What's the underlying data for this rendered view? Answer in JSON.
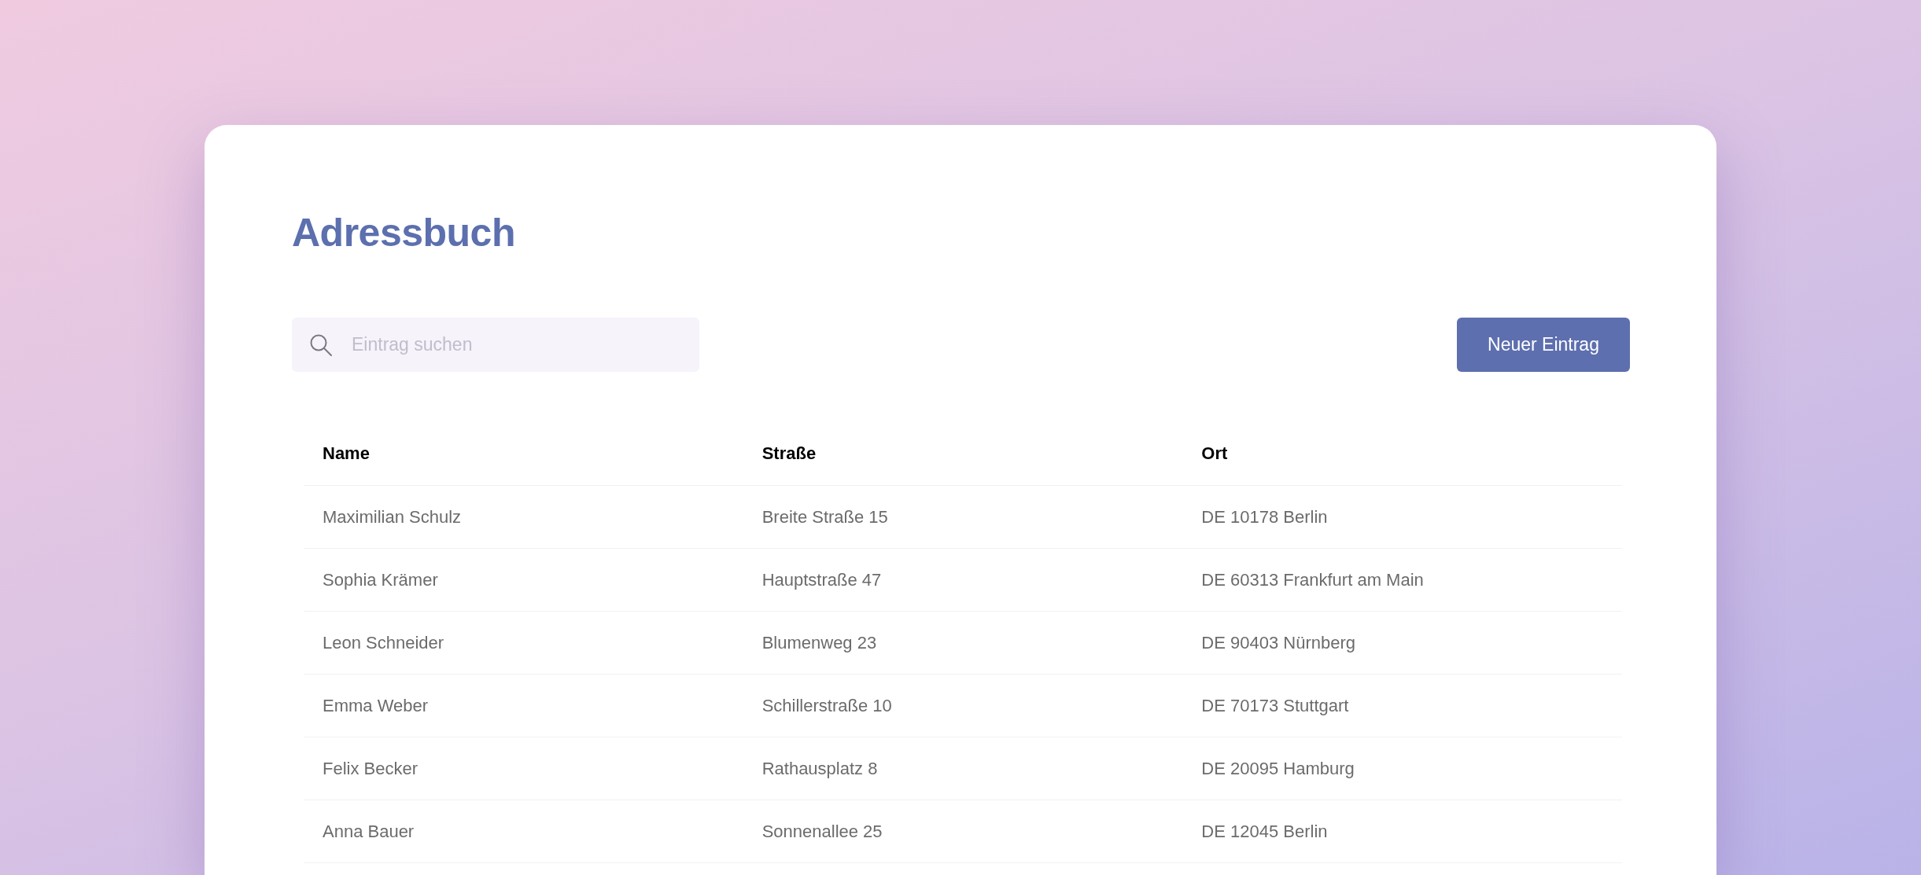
{
  "title": "Adressbuch",
  "search": {
    "placeholder": "Eintrag suchen"
  },
  "new_button": "Neuer Eintrag",
  "table": {
    "columns": [
      "Name",
      "Straße",
      "Ort"
    ],
    "rows": [
      [
        "Maximilian Schulz",
        "Breite Straße 15",
        "DE 10178 Berlin"
      ],
      [
        "Sophia Krämer",
        "Hauptstraße 47",
        "DE 60313 Frankfurt am Main"
      ],
      [
        "Leon Schneider",
        "Blumenweg 23",
        "DE 90403 Nürnberg"
      ],
      [
        "Emma Weber",
        "Schillerstraße 10",
        "DE 70173 Stuttgart"
      ],
      [
        "Felix Becker",
        "Rathausplatz 8",
        "DE 20095 Hamburg"
      ],
      [
        "Anna Bauer",
        "Sonnenallee 25",
        "DE 12045 Berlin"
      ]
    ]
  }
}
